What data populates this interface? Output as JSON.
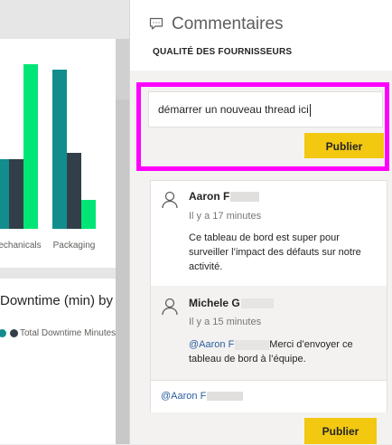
{
  "dashboard": {
    "bar_chart": {
      "categories": [
        "Mechanicals",
        "Packaging"
      ],
      "category_labels": [
        "echanicals",
        "Packaging"
      ],
      "colors": [
        "#118d8d",
        "#333f48",
        "#00e676"
      ]
    },
    "tile2": {
      "title": "Downtime (min) by M",
      "legend_label": "Total Downtime Minutes"
    }
  },
  "pane": {
    "title": "Commentaires",
    "subtitle": "QUALITÉ DES FOURNISSEURS",
    "icon": "comment-icon",
    "new_thread": {
      "value": "démarrer un nouveau thread ici",
      "publish_label": "Publier"
    },
    "comments": [
      {
        "author": "Aaron F",
        "time": "Il y a 17 minutes",
        "body": "Ce tableau de bord est super pour surveiller l’impact des défauts sur notre activité."
      },
      {
        "author": "Michele G",
        "time": "Il y a 15 minutes",
        "mention": "@Aaron F",
        "body": "Merci d’envoyer ce tableau de bord à l’équipe."
      }
    ],
    "reply": {
      "value": "@Aaron F",
      "publish_label": "Publier"
    }
  },
  "colors": {
    "publish_button": "#f2c811",
    "highlight_border": "#ff00ff",
    "mention": "#2b5e9e"
  }
}
